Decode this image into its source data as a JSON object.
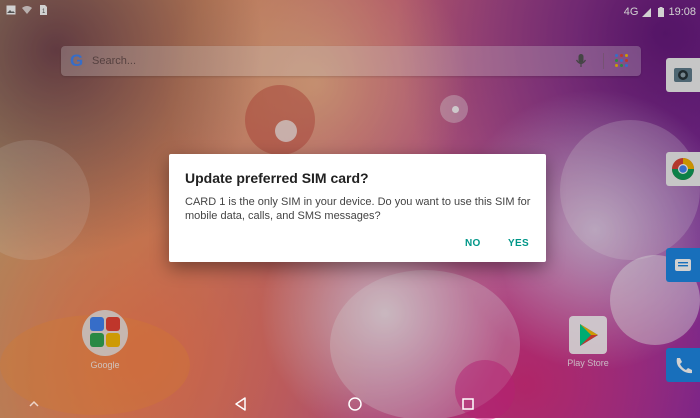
{
  "status_bar": {
    "left_icons": [
      "image-notification-icon",
      "wifi-icon",
      "sim-notification-icon"
    ],
    "network": "4G",
    "time": "19:08"
  },
  "search": {
    "placeholder": "Search..."
  },
  "dialog": {
    "title": "Update preferred SIM card?",
    "message": "CARD 1 is the only SIM in your device. Do you want to use this SIM for mobile data, calls, and SMS messages?",
    "no_label": "NO",
    "yes_label": "YES",
    "accent_color": "#009688"
  },
  "apps": {
    "google_folder": "Google",
    "play_store": "Play Store"
  },
  "edge_dock": [
    "camera-icon",
    "chrome-icon",
    "messages-icon",
    "phone-icon"
  ],
  "nav": [
    "back-icon",
    "home-icon",
    "recents-icon"
  ]
}
